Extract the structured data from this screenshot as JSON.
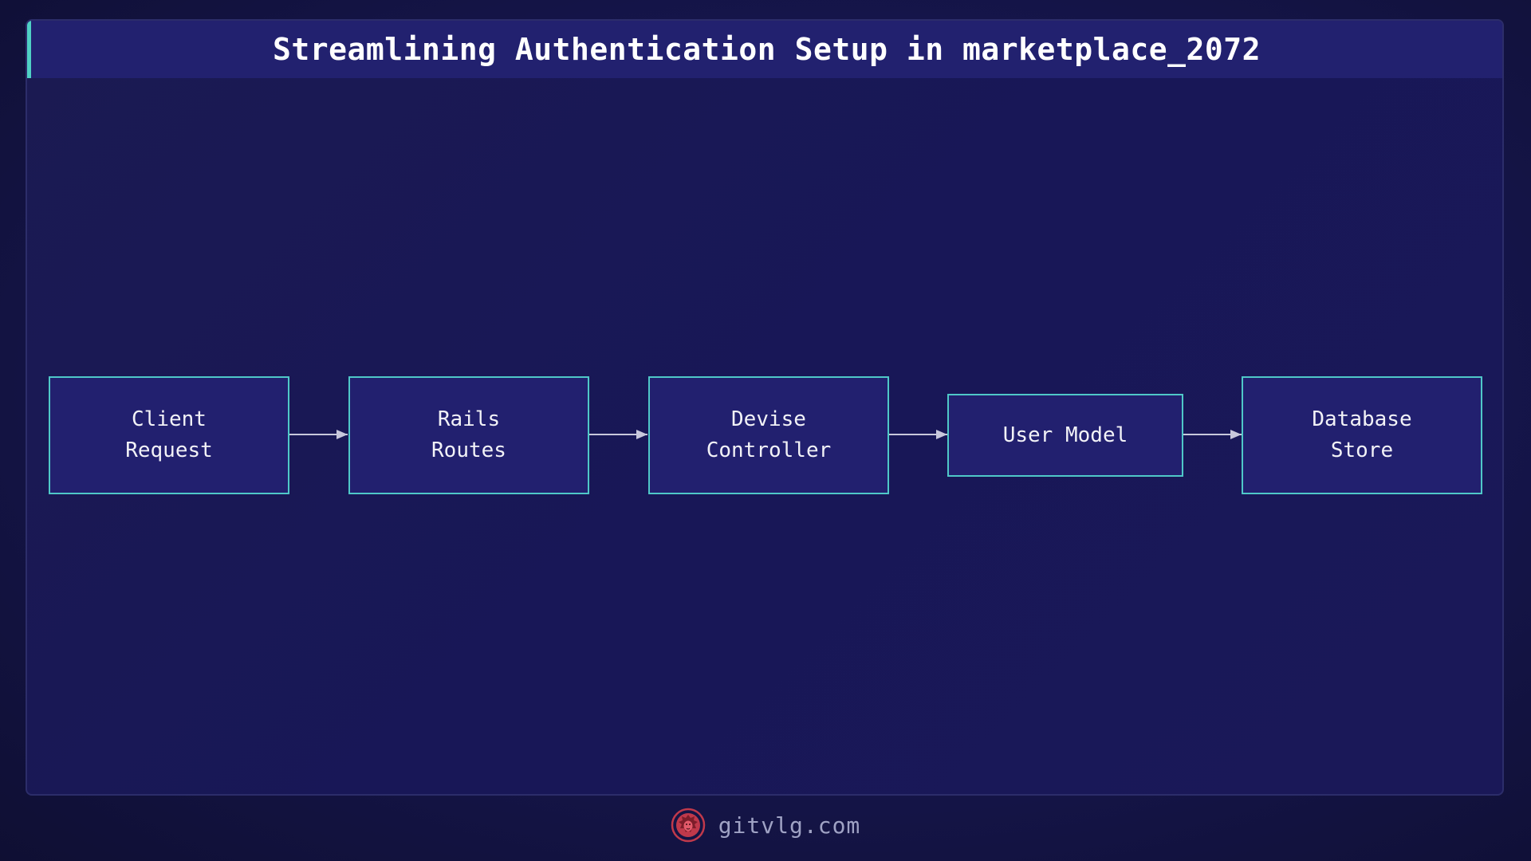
{
  "header": {
    "title": "Streamlining Authentication Setup in marketplace_2072"
  },
  "diagram": {
    "nodes": [
      {
        "id": "client-request",
        "label": "Client\nRequest"
      },
      {
        "id": "rails-routes",
        "label": "Rails\nRoutes"
      },
      {
        "id": "devise-controller",
        "label": "Devise\nController"
      },
      {
        "id": "user-model",
        "label": "User Model"
      },
      {
        "id": "database-store",
        "label": "Database\nStore"
      }
    ],
    "edges": [
      {
        "from": "client-request",
        "to": "rails-routes"
      },
      {
        "from": "rails-routes",
        "to": "devise-controller"
      },
      {
        "from": "devise-controller",
        "to": "user-model"
      },
      {
        "from": "user-model",
        "to": "database-store"
      }
    ]
  },
  "footer": {
    "site": "gitvlg.com",
    "logo_icon": "lion-logo-icon"
  },
  "colors": {
    "background": "#15154a",
    "header": "#22216f",
    "accent": "#4fd1c5",
    "node_fill": "#22206f",
    "node_border": "#4fc8c8",
    "arrow": "#c8c8dc",
    "logo": "#c0394b"
  }
}
